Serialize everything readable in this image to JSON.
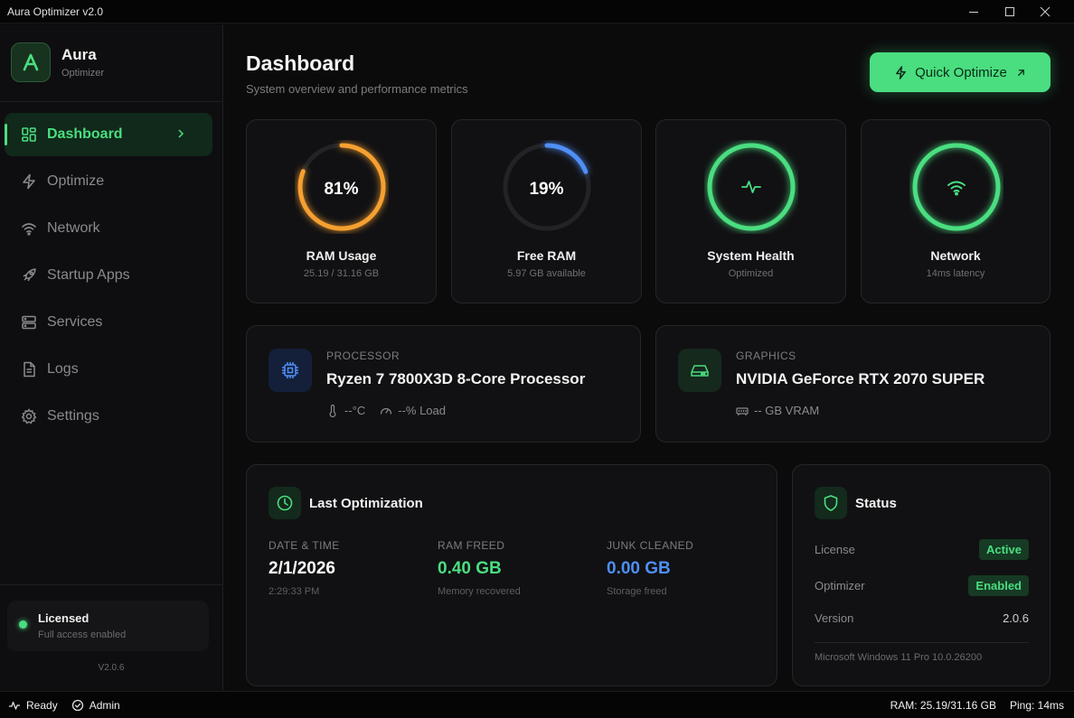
{
  "window": {
    "title": "Aura Optimizer v2.0"
  },
  "brand": {
    "name": "Aura",
    "subtitle": "Optimizer"
  },
  "nav": [
    {
      "label": "Dashboard",
      "icon": "grid-icon",
      "active": true
    },
    {
      "label": "Optimize",
      "icon": "bolt-icon"
    },
    {
      "label": "Network",
      "icon": "wifi-icon"
    },
    {
      "label": "Startup Apps",
      "icon": "rocket-icon"
    },
    {
      "label": "Services",
      "icon": "server-icon"
    },
    {
      "label": "Logs",
      "icon": "file-icon"
    },
    {
      "label": "Settings",
      "icon": "gear-icon"
    }
  ],
  "license": {
    "title": "Licensed",
    "subtitle": "Full access enabled",
    "version": "V2.0.6"
  },
  "header": {
    "title": "Dashboard",
    "subtitle": "System overview and performance metrics",
    "quick_optimize": "Quick Optimize"
  },
  "gauges": [
    {
      "value": "81%",
      "percent": 81,
      "label": "RAM Usage",
      "sub": "25.19 / 31.16 GB",
      "color": "#f5a030"
    },
    {
      "value": "19%",
      "percent": 19,
      "label": "Free RAM",
      "sub": "5.97 GB available",
      "color": "#4f8ff7"
    },
    {
      "icon": "pulse-icon",
      "percent": 100,
      "label": "System Health",
      "sub": "Optimized",
      "color": "#4ade80"
    },
    {
      "icon": "wifi-icon",
      "percent": 100,
      "label": "Network",
      "sub": "14ms latency",
      "color": "#4ade80"
    }
  ],
  "processor": {
    "category": "PROCESSOR",
    "name": "Ryzen 7 7800X3D 8-Core Processor",
    "temp": "--°C",
    "load": "--% Load"
  },
  "graphics": {
    "category": "GRAPHICS",
    "name": "NVIDIA GeForce RTX 2070 SUPER",
    "vram": "-- GB VRAM"
  },
  "last_optimization": {
    "title": "Last Optimization",
    "date_label": "DATE & TIME",
    "date": "2/1/2026",
    "time": "2:29:33 PM",
    "ram_label": "RAM FREED",
    "ram": "0.40 GB",
    "ram_sub": "Memory recovered",
    "junk_label": "JUNK CLEANED",
    "junk": "0.00 GB",
    "junk_sub": "Storage freed"
  },
  "status": {
    "title": "Status",
    "license_label": "License",
    "license_value": "Active",
    "optimizer_label": "Optimizer",
    "optimizer_value": "Enabled",
    "version_label": "Version",
    "version_value": "2.0.6",
    "os": "Microsoft Windows 11 Pro 10.0.26200"
  },
  "statusbar": {
    "ready": "Ready",
    "admin": "Admin",
    "ram": "RAM: 25.19/31.16 GB",
    "ping": "Ping: 14ms"
  },
  "colors": {
    "accent": "#4ade80",
    "orange": "#f5a030",
    "blue": "#4f8ff7"
  }
}
